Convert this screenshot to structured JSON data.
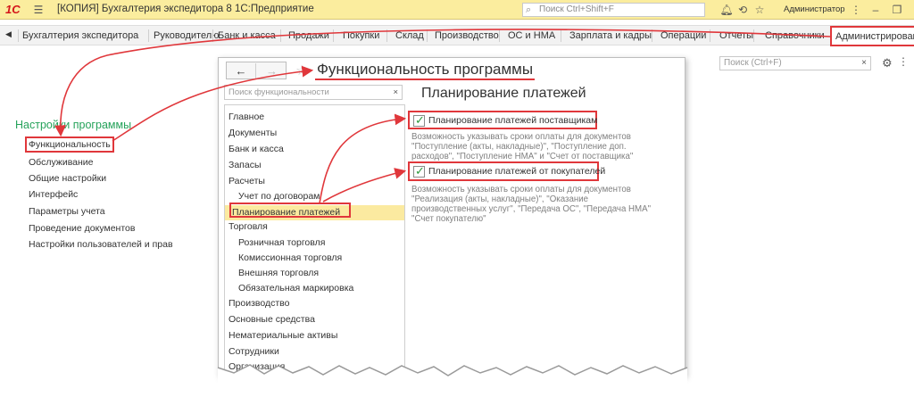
{
  "titlebar": {
    "logo": "1С",
    "title": "[КОПИЯ] Бухгалтерия экспедитора 8 1С:Предприятие",
    "search_placeholder": "Поиск Ctrl+Shift+F",
    "user": "Администратор",
    "icons": [
      "menu-icon",
      "home-icon",
      "bell-icon",
      "history-icon",
      "star-icon",
      "more-icon",
      "minimize-icon",
      "restore-icon"
    ]
  },
  "sections": {
    "items": [
      "Бухгалтерия экспедитора",
      "Руководителю",
      "Банк и касса",
      "Продажи",
      "Покупки",
      "Склад",
      "Производство",
      "ОС и НМА",
      "Зарплата и кадры",
      "Операции",
      "Отчеты",
      "Справочники",
      "Администрирование"
    ],
    "active_index": 12
  },
  "left_nav": {
    "heading": "Настройки программы",
    "items": [
      "Функциональность",
      "Обслуживание",
      "Общие настройки",
      "Интерфейс",
      "Параметры учета",
      "Проведение документов",
      "Настройки пользователей и прав"
    ],
    "selected_index": 0
  },
  "right_search": {
    "placeholder": "Поиск (Ctrl+F)",
    "clear": "×"
  },
  "dialog": {
    "title": "Функциональность программы",
    "back": "←",
    "forward": "→",
    "search_placeholder": "Поиск функциональности",
    "search_clear": "×",
    "tree": [
      {
        "label": "Главное",
        "level": 1
      },
      {
        "label": "Документы",
        "level": 1
      },
      {
        "label": "Банк и касса",
        "level": 1
      },
      {
        "label": "Запасы",
        "level": 1
      },
      {
        "label": "Расчеты",
        "level": 1
      },
      {
        "label": "Учет по договорам",
        "level": 2
      },
      {
        "label": "Планирование платежей",
        "level": 2,
        "selected": true
      },
      {
        "label": "Торговля",
        "level": 1
      },
      {
        "label": "Розничная торговля",
        "level": 2
      },
      {
        "label": "Комиссионная торговля",
        "level": 2
      },
      {
        "label": "Внешняя торговля",
        "level": 2
      },
      {
        "label": "Обязательная маркировка",
        "level": 2
      },
      {
        "label": "Производство",
        "level": 1
      },
      {
        "label": "Основные средства",
        "level": 1
      },
      {
        "label": "Нематериальные активы",
        "level": 1
      },
      {
        "label": "Сотрудники",
        "level": 1
      },
      {
        "label": "Организация",
        "level": 1
      }
    ],
    "panel": {
      "title": "Планирование платежей",
      "options": [
        {
          "label": "Планирование платежей поставщикам",
          "checked": true,
          "description": [
            "Возможность указывать сроки оплаты для документов",
            "\"Поступление (акты, накладные)\", \"Поступление доп.",
            "расходов\", \"Поступление НМА\" и \"Счет от поставщика\""
          ]
        },
        {
          "label": "Планирование платежей от покупателей",
          "checked": true,
          "description": [
            "Возможность указывать сроки оплаты для документов",
            "\"Реализация (акты, накладные)\", \"Оказание",
            "производственных услуг\", \"Передача ОС\", \"Передача НМА\"",
            "\"Счет покупателю\""
          ]
        }
      ]
    }
  },
  "colors": {
    "title_bar": "#fbed9e",
    "highlight_red": "#e0373b",
    "nav_heading_green": "#25a25a",
    "selected_row": "#fbeaa0",
    "checkmark_green": "#2c9a3d"
  }
}
